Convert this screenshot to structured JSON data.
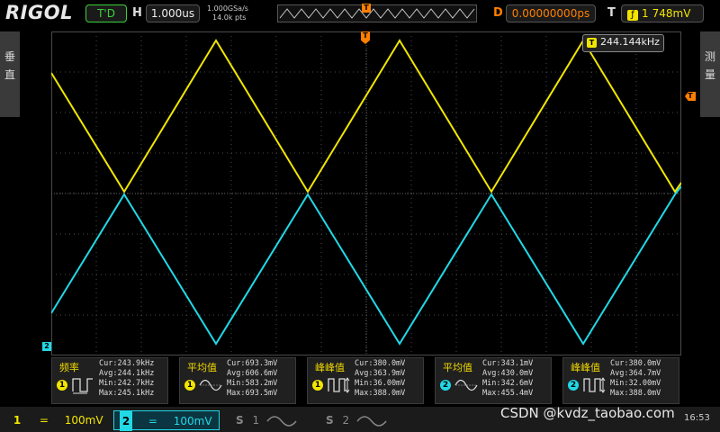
{
  "brand": "RIGOL",
  "trigger_status": "T'D",
  "timebase": {
    "label": "H",
    "value": "1.000us"
  },
  "acquisition": {
    "rate": "1.000GSa/s",
    "points": "14.0k pts"
  },
  "delay": {
    "label": "D",
    "value": "0.00000000ps"
  },
  "trigger": {
    "label": "T",
    "level": "748mV"
  },
  "side_tabs": {
    "left": [
      "垂",
      "直"
    ],
    "right": [
      "测",
      "量"
    ]
  },
  "freq_counter": "244.144kHz",
  "markers": {
    "ch1": "1",
    "ch2": "2",
    "trig": "T"
  },
  "measurements": [
    {
      "title": "频率",
      "channel": "1",
      "icon": "period-icon",
      "cur": "Cur:243.9kHz",
      "avg": "Avg:244.1kHz",
      "min": "Min:242.7kHz",
      "max": "Max:245.1kHz"
    },
    {
      "title": "平均值",
      "channel": "1",
      "icon": "average-icon",
      "cur": "Cur:693.3mV",
      "avg": "Avg:606.6mV",
      "min": "Min:583.2mV",
      "max": "Max:693.5mV"
    },
    {
      "title": "峰峰值",
      "channel": "1",
      "icon": "peak-peak-icon",
      "cur": "Cur:380.0mV",
      "avg": "Avg:363.9mV",
      "min": "Min:36.00mV",
      "max": "Max:388.0mV"
    },
    {
      "title": "平均值",
      "channel": "2",
      "icon": "average-icon",
      "cur": "Cur:343.1mV",
      "avg": "Avg:430.0mV",
      "min": "Min:342.6mV",
      "max": "Max:455.4mV"
    },
    {
      "title": "峰峰值",
      "channel": "2",
      "icon": "peak-peak-icon",
      "cur": "Cur:380.0mV",
      "avg": "Avg:364.7mV",
      "min": "Min:32.00mV",
      "max": "Max:388.0mV"
    }
  ],
  "channels": [
    {
      "id": "1",
      "coupling": "=",
      "scale": "100mV",
      "color": "#f2e600"
    },
    {
      "id": "2",
      "coupling": "=",
      "scale": "100mV",
      "color": "#22d8e6"
    }
  ],
  "math": [
    {
      "id": "S",
      "sub": "1"
    },
    {
      "id": "S",
      "sub": "2"
    }
  ],
  "watermark": "CSDN @kvdz_taobao.com",
  "clock": "16:53",
  "colors": {
    "ch1": "#f2e600",
    "ch2": "#22d8e6",
    "trigger": "#ff7f00",
    "grid": "#4a4a4a"
  }
}
